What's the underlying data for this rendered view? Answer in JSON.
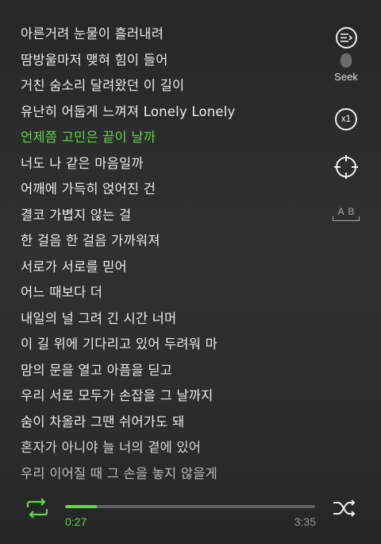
{
  "lyrics": [
    "아른거려 눈물이 흘러내려",
    "땀방울마저 맺혀 힘이 들어",
    "거친 숨소리 달려왔던 이 길이",
    "유난히 어둡게 느껴져 Lonely Lonely",
    "언제쯤 고민은 끝이 날까",
    "너도 나 같은 마음일까",
    "어깨에 가득히 얹어진 건",
    "결코 가볍지 않는 걸",
    "한 걸음 한 걸음 가까워져",
    "서로가 서로를 믿어",
    "어느 때보다 더",
    "내일의 널 그려 긴 시간 너머",
    "이 길 위에 기다리고 있어 두려워 마",
    "맘의 문을 열고 아픔을 딛고",
    "우리 서로 모두가 손잡을 그 날까지",
    "숨이 차올라 그땐 쉬어가도 돼",
    "혼자가 아니야 늘 너의 곁에 있어",
    "우리 이어질 때 그 손을 놓지 않을게"
  ],
  "active_line_index": 4,
  "side": {
    "seek_icon": "seek-list-icon",
    "seek_label": "Seek",
    "speed_label": "x1",
    "locate_icon": "crosshair-icon",
    "ab_label": "AB"
  },
  "player": {
    "current_time": "0:27",
    "total_time": "3:35",
    "progress": 0.126,
    "repeat_icon": "repeat-icon",
    "shuffle_icon": "shuffle-icon"
  },
  "colors": {
    "accent": "#66d34e",
    "text": "#ececec",
    "muted": "#9a9a9a"
  }
}
